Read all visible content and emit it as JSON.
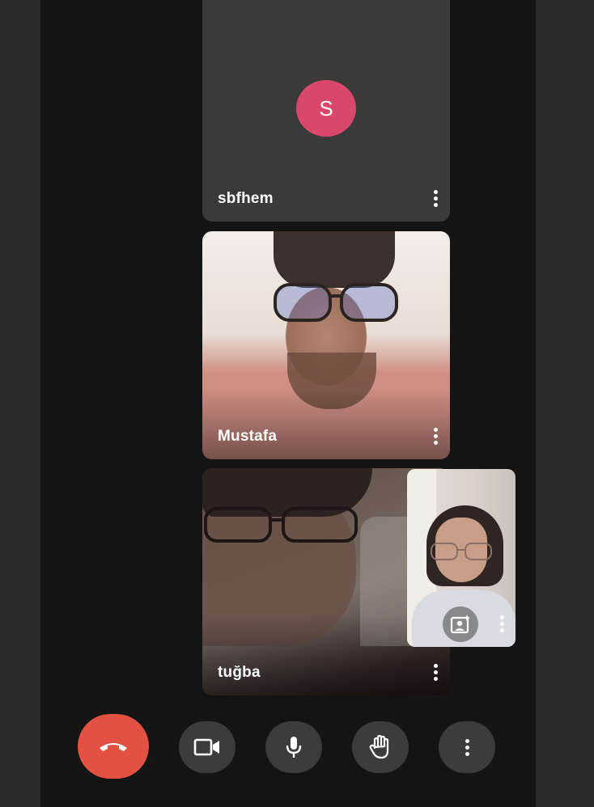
{
  "participants": [
    {
      "name": "sbfhem",
      "avatar_initial": "S",
      "avatar_color": "#d9486a"
    },
    {
      "name": "Mustafa"
    },
    {
      "name": "tuğba"
    }
  ],
  "self_view": {
    "effects_icon": "portrait-sparkle-icon",
    "menu_icon": "more-vert-icon"
  },
  "controls": [
    {
      "id": "end-call",
      "icon": "phone-hangup-icon",
      "color": "#e25141"
    },
    {
      "id": "camera",
      "icon": "videocam-icon"
    },
    {
      "id": "microphone",
      "icon": "mic-icon"
    },
    {
      "id": "raise-hand",
      "icon": "hand-icon"
    },
    {
      "id": "more-options",
      "icon": "more-vert-icon"
    }
  ],
  "colors": {
    "background": "#141414",
    "tile": "#3a3a3a",
    "control": "#3c3c3c"
  }
}
